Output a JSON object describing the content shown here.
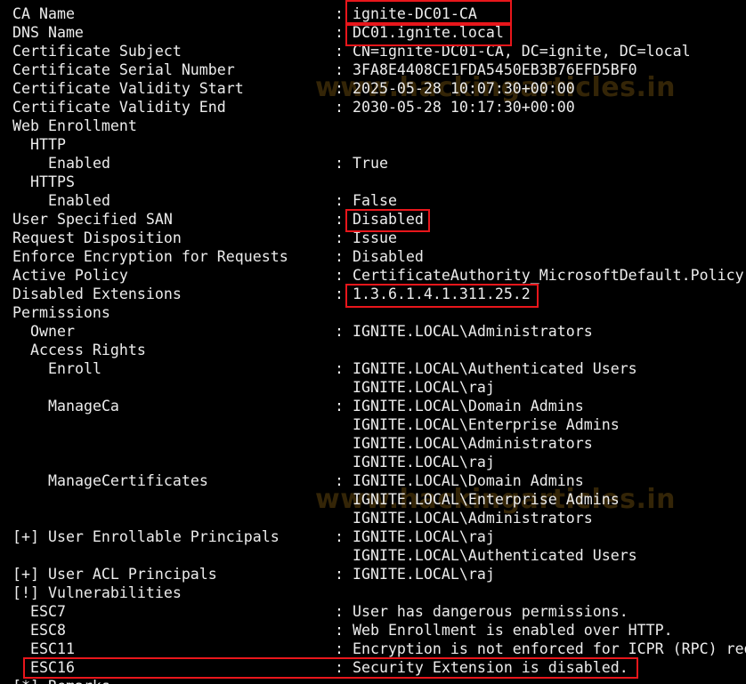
{
  "accent_highlight_color": "#e8161b",
  "watermark_text": "www.hackingarticles.in",
  "lines": [
    {
      "indent": 0,
      "key": "CA Name",
      "value": ": ignite-DC01-CA"
    },
    {
      "indent": 0,
      "key": "DNS Name",
      "value": ": DC01.ignite.local"
    },
    {
      "indent": 0,
      "key": "Certificate Subject",
      "value": ": CN=ignite-DC01-CA, DC=ignite, DC=local"
    },
    {
      "indent": 0,
      "key": "Certificate Serial Number",
      "value": ": 3FA8E4408CE1FDA5450EB3B76EFD5BF0"
    },
    {
      "indent": 0,
      "key": "Certificate Validity Start",
      "value": ": 2025-05-28 10:07:30+00:00"
    },
    {
      "indent": 0,
      "key": "Certificate Validity End",
      "value": ": 2030-05-28 10:17:30+00:00"
    },
    {
      "indent": 0,
      "key": "Web Enrollment",
      "value": ""
    },
    {
      "indent": 1,
      "key": "HTTP",
      "value": ""
    },
    {
      "indent": 2,
      "key": "Enabled",
      "value": ": True"
    },
    {
      "indent": 1,
      "key": "HTTPS",
      "value": ""
    },
    {
      "indent": 2,
      "key": "Enabled",
      "value": ": False"
    },
    {
      "indent": 0,
      "key": "User Specified SAN",
      "value": ": Disabled"
    },
    {
      "indent": 0,
      "key": "Request Disposition",
      "value": ": Issue"
    },
    {
      "indent": 0,
      "key": "Enforce Encryption for Requests",
      "value": ": Disabled"
    },
    {
      "indent": 0,
      "key": "Active Policy",
      "value": ": CertificateAuthority_MicrosoftDefault.Policy"
    },
    {
      "indent": 0,
      "key": "Disabled Extensions",
      "value": ": 1.3.6.1.4.1.311.25.2"
    },
    {
      "indent": 0,
      "key": "Permissions",
      "value": ""
    },
    {
      "indent": 1,
      "key": "Owner",
      "value": ": IGNITE.LOCAL\\Administrators"
    },
    {
      "indent": 1,
      "key": "Access Rights",
      "value": ""
    },
    {
      "indent": 2,
      "key": "Enroll",
      "value": ": IGNITE.LOCAL\\Authenticated Users"
    },
    {
      "indent": 0,
      "key": "",
      "value": "  IGNITE.LOCAL\\raj"
    },
    {
      "indent": 2,
      "key": "ManageCa",
      "value": ": IGNITE.LOCAL\\Domain Admins"
    },
    {
      "indent": 0,
      "key": "",
      "value": "  IGNITE.LOCAL\\Enterprise Admins"
    },
    {
      "indent": 0,
      "key": "",
      "value": "  IGNITE.LOCAL\\Administrators"
    },
    {
      "indent": 0,
      "key": "",
      "value": "  IGNITE.LOCAL\\raj"
    },
    {
      "indent": 2,
      "key": "ManageCertificates",
      "value": ": IGNITE.LOCAL\\Domain Admins"
    },
    {
      "indent": 0,
      "key": "",
      "value": "  IGNITE.LOCAL\\Enterprise Admins"
    },
    {
      "indent": 0,
      "key": "",
      "value": "  IGNITE.LOCAL\\Administrators"
    },
    {
      "indent": 0,
      "key": "[+] User Enrollable Principals",
      "value": ": IGNITE.LOCAL\\raj"
    },
    {
      "indent": 0,
      "key": "",
      "value": "  IGNITE.LOCAL\\Authenticated Users"
    },
    {
      "indent": 0,
      "key": "[+] User ACL Principals",
      "value": ": IGNITE.LOCAL\\raj"
    },
    {
      "indent": 0,
      "key": "[!] Vulnerabilities",
      "value": ""
    },
    {
      "indent": 1,
      "key": "ESC7",
      "value": ": User has dangerous permissions."
    },
    {
      "indent": 1,
      "key": "ESC8",
      "value": ": Web Enrollment is enabled over HTTP."
    },
    {
      "indent": 1,
      "key": "ESC11",
      "value": ": Encryption is not enforced for ICPR (RPC) requests."
    },
    {
      "indent": 1,
      "key": "ESC16",
      "value": ": Security Extension is disabled."
    },
    {
      "indent": 0,
      "key": "[*] Remarks",
      "value": ""
    }
  ]
}
